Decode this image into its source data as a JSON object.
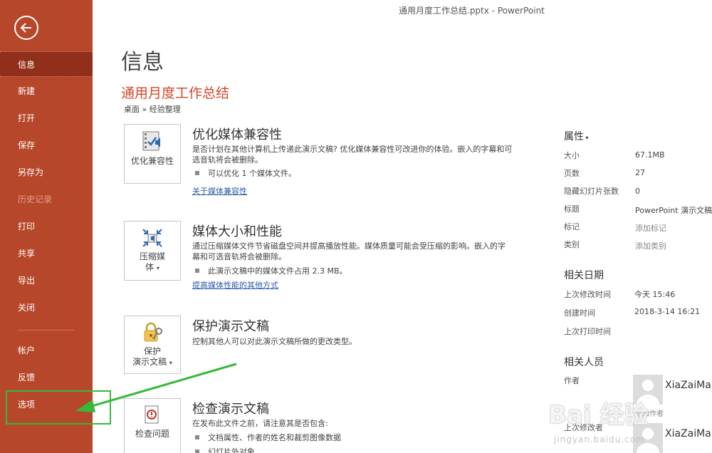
{
  "window": {
    "title": "通用月度工作总结.pptx  -  PowerPoint"
  },
  "sidebar": {
    "items": [
      {
        "label": "信息"
      },
      {
        "label": "新建"
      },
      {
        "label": "打开"
      },
      {
        "label": "保存"
      },
      {
        "label": "另存为"
      },
      {
        "label": "历史记录"
      },
      {
        "label": "打印"
      },
      {
        "label": "共享"
      },
      {
        "label": "导出"
      },
      {
        "label": "关闭"
      },
      {
        "label": "帐户"
      },
      {
        "label": "反馈"
      },
      {
        "label": "选项"
      }
    ]
  },
  "main": {
    "heading": "信息",
    "doc_title": "通用月度工作总结",
    "breadcrumb": "桌面 » 经验整理",
    "sections": [
      {
        "button": "优化兼容性",
        "title": "优化媒体兼容性",
        "description": "是否计划在其他计算机上传递此演示文稿? 优化媒体兼容性可改进你的体验。嵌入的字幕和可选音轨将会被删除。",
        "bullet": "可以优化 1 个媒体文件。",
        "link": "关于媒体兼容性",
        "icon": "film-speaker-check-icon"
      },
      {
        "button_line1": "压缩媒",
        "button_line2": "体",
        "title": "媒体大小和性能",
        "description": "通过压缩媒体文件节省磁盘空间并提高播放性能。媒体质量可能会受压缩的影响。嵌入的字幕和可选音轨将会被删除。",
        "bullet": "此演示文稿中的媒体文件占用 2.3 MB。",
        "link": "提高媒体性能的其他方式",
        "icon": "compress-media-icon"
      },
      {
        "button_line1": "保护",
        "button_line2": "演示文稿",
        "title": "保护演示文稿",
        "description": "控制其他人可以对此演示文稿所做的更改类型。",
        "icon": "lock-key-icon"
      },
      {
        "button": "检查问题",
        "title": "检查演示文稿",
        "description": "在发布此文件之前，请注意其是否包含:",
        "bullets": [
          "文档属性、作者的姓名和裁剪图像数据",
          "幻灯片外对象"
        ],
        "icon": "inspect-document-icon"
      }
    ]
  },
  "properties": {
    "heading": "属性",
    "rows": [
      {
        "key": "大小",
        "value": "67.1MB"
      },
      {
        "key": "页数",
        "value": "27"
      },
      {
        "key": "隐藏幻灯片张数",
        "value": "0"
      },
      {
        "key": "标题",
        "value": "PowerPoint 演示文稿"
      },
      {
        "key": "标记",
        "value": "添加标记"
      },
      {
        "key": "类别",
        "value": "添加类别"
      }
    ]
  },
  "dates": {
    "heading": "相关日期",
    "rows": [
      {
        "key": "上次修改时间",
        "value": "今天 15:46"
      },
      {
        "key": "创建时间",
        "value": "2018-3-14 16:21"
      },
      {
        "key": "上次打印时间",
        "value": ""
      }
    ]
  },
  "people": {
    "heading": "相关人员",
    "author_label": "作者",
    "author_name": "XiaZaiMa.C",
    "add_author": "添加作者",
    "last_modified_label": "上次修改者",
    "last_modified_name": "XiaZaiMa.C"
  },
  "watermark": {
    "brand": "Bai 经验",
    "url": "jingyan.baidu.com"
  },
  "colors": {
    "sidebar": "#b7472a",
    "sidebar_active": "#912f1b",
    "accent_title": "#d24726",
    "link": "#2a5ca8",
    "annotation": "#36b83a"
  }
}
